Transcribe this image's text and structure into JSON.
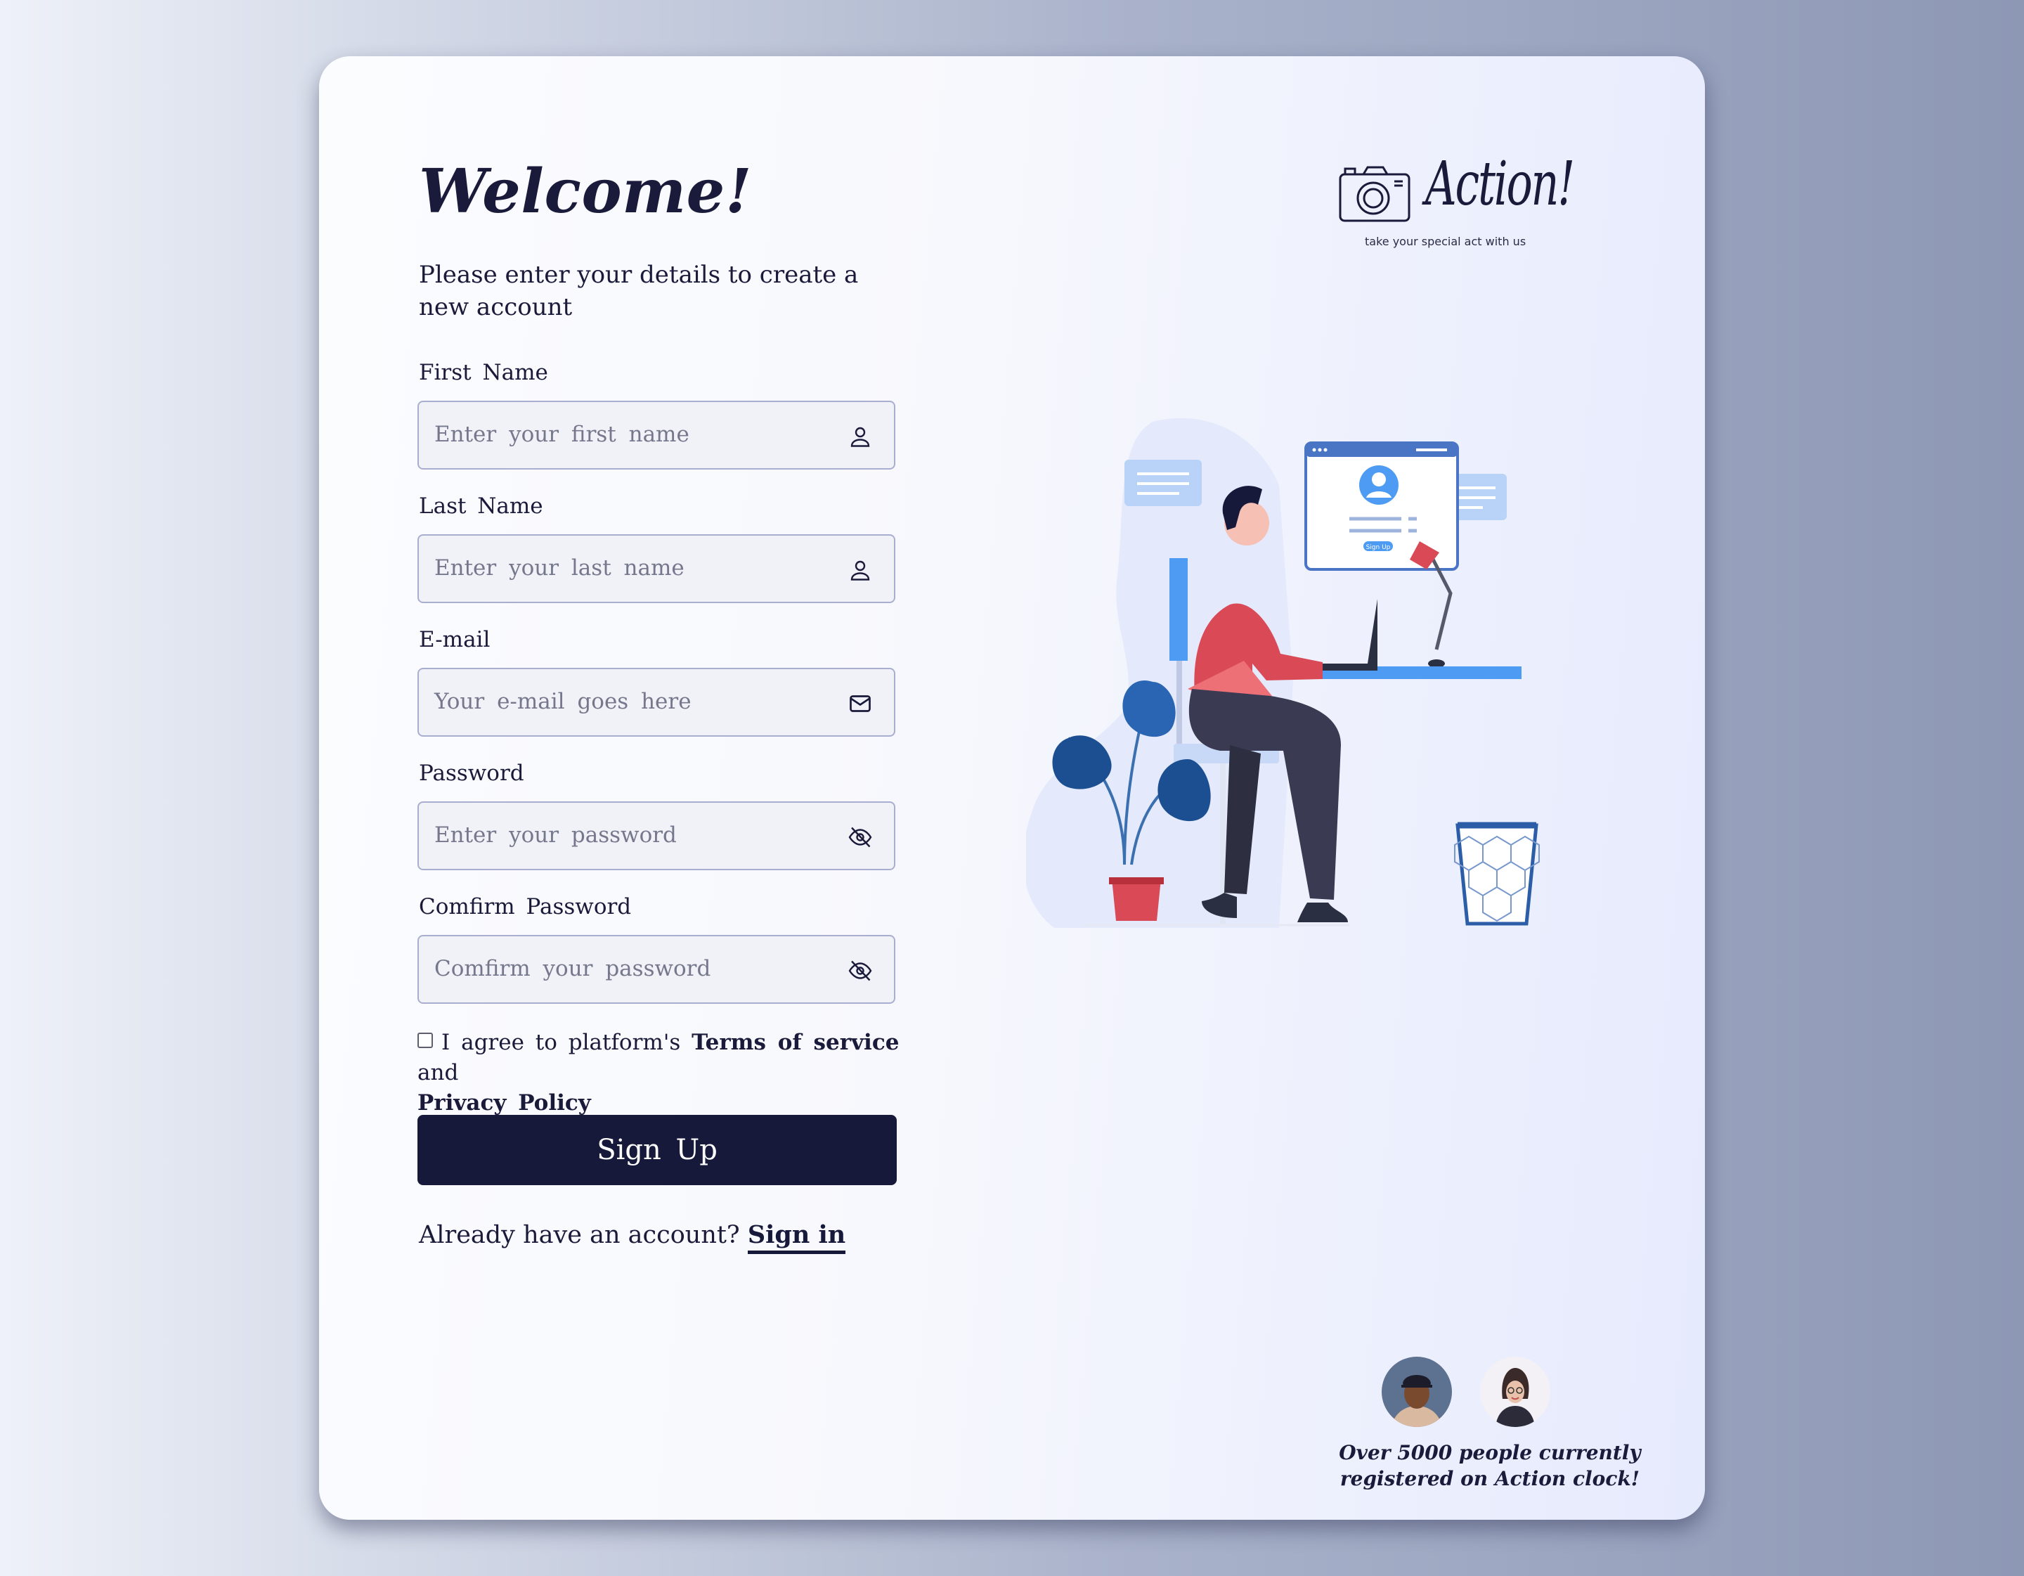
{
  "header": {
    "title": "Welcome!",
    "subtitle": "Please enter your details to create a new account"
  },
  "form": {
    "first_name": {
      "label": "First Name",
      "placeholder": "Enter your first name",
      "icon": "user-icon"
    },
    "last_name": {
      "label": "Last Name",
      "placeholder": "Enter your last name",
      "icon": "user-icon"
    },
    "email": {
      "label": "E-mail",
      "placeholder": "Your e-mail goes here",
      "icon": "mail-icon"
    },
    "password": {
      "label": "Password",
      "placeholder": "Enter your password",
      "icon": "eye-off-icon"
    },
    "confirm_password": {
      "label": "Comfirm Password",
      "placeholder": "Comfirm your password",
      "icon": "eye-off-icon"
    },
    "agree": {
      "checked": false,
      "text_before": "I agree to platform's ",
      "terms": "Terms of service",
      "and": " and ",
      "privacy": "Privacy Policy"
    },
    "submit_label": "Sign Up",
    "signin_prompt": "Already have an account? ",
    "signin_link": "Sign in"
  },
  "brand": {
    "name": "Action!",
    "tagline": "take your special act with us",
    "icon": "camera-icon"
  },
  "illustration": {
    "screen_button": "Sign Up"
  },
  "social_proof": {
    "text_line1": "Over 5000 people currently",
    "text_line2": "registered on Action clock!"
  },
  "colors": {
    "primary": "#17193b",
    "accent_blue": "#4d9bf3",
    "accent_red": "#d94a56"
  }
}
